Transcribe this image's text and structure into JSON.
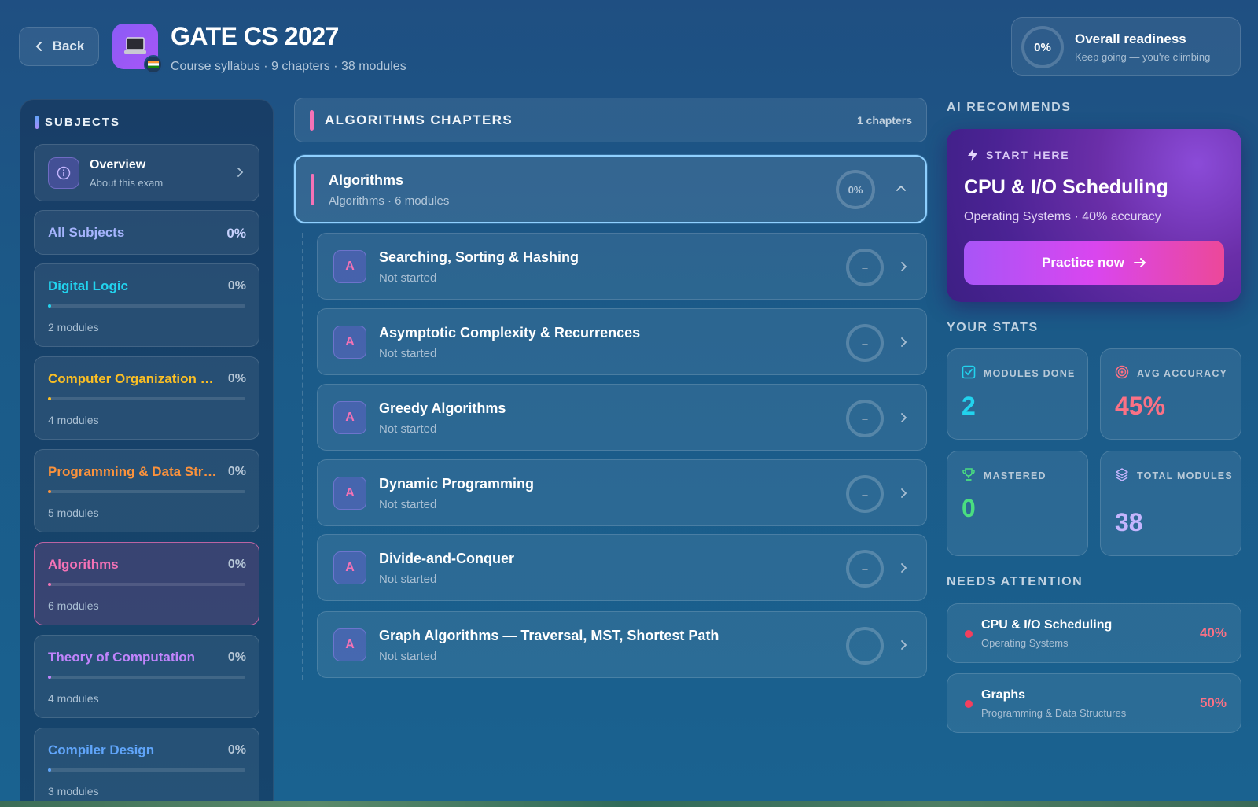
{
  "header": {
    "back_label": "Back",
    "title": "GATE CS 2027",
    "subtitle": "Course syllabus · 9 chapters · 38 modules",
    "readiness": {
      "percent": "0%",
      "title": "Overall readiness",
      "subtitle": "Keep going — you're climbing"
    }
  },
  "sidebar": {
    "heading": "SUBJECTS",
    "overview": {
      "title": "Overview",
      "subtitle": "About this exam"
    },
    "all_subjects": {
      "label": "All Subjects",
      "percent": "0%"
    },
    "subjects": [
      {
        "name": "Digital Logic",
        "percent": "0%",
        "modules": "2 modules",
        "color": "#22d3ee"
      },
      {
        "name": "Computer Organization & Architecture",
        "percent": "0%",
        "modules": "4 modules",
        "color": "#fbbf24"
      },
      {
        "name": "Programming & Data Structures",
        "percent": "0%",
        "modules": "5 modules",
        "color": "#fb923c"
      },
      {
        "name": "Algorithms",
        "percent": "0%",
        "modules": "6 modules",
        "color": "#f472b6"
      },
      {
        "name": "Theory of Computation",
        "percent": "0%",
        "modules": "4 modules",
        "color": "#c084fc"
      },
      {
        "name": "Compiler Design",
        "percent": "0%",
        "modules": "3 modules",
        "color": "#60a5fa"
      }
    ]
  },
  "chapters": {
    "heading": "ALGORITHMS CHAPTERS",
    "count": "1 chapters",
    "chapter": {
      "name": "Algorithms",
      "subtitle": "Algorithms · 6 modules",
      "percent": "0%"
    },
    "modules": [
      {
        "badge": "A",
        "name": "Searching, Sorting & Hashing",
        "status": "Not started",
        "ring": "–"
      },
      {
        "badge": "A",
        "name": "Asymptotic Complexity & Recurrences",
        "status": "Not started",
        "ring": "–"
      },
      {
        "badge": "A",
        "name": "Greedy Algorithms",
        "status": "Not started",
        "ring": "–"
      },
      {
        "badge": "A",
        "name": "Dynamic Programming",
        "status": "Not started",
        "ring": "–"
      },
      {
        "badge": "A",
        "name": "Divide-and-Conquer",
        "status": "Not started",
        "ring": "–"
      },
      {
        "badge": "A",
        "name": "Graph Algorithms — Traversal, MST, Shortest Path",
        "status": "Not started",
        "ring": "–"
      }
    ]
  },
  "recommend": {
    "section": "AI RECOMMENDS",
    "tag": "START HERE",
    "title": "CPU & I/O Scheduling",
    "subtitle": "Operating Systems · 40% accuracy",
    "button": "Practice now"
  },
  "stats": {
    "section": "YOUR STATS",
    "items": [
      {
        "label": "MODULES DONE",
        "value": "2",
        "color": "#22d3ee"
      },
      {
        "label": "AVG ACCURACY",
        "value": "45%",
        "color": "#fb7185"
      },
      {
        "label": "MASTERED",
        "value": "0",
        "color": "#4ade80"
      },
      {
        "label": "TOTAL MODULES",
        "value": "38",
        "color": "#c4b5fd"
      }
    ]
  },
  "attention": {
    "section": "NEEDS ATTENTION",
    "items": [
      {
        "title": "CPU & I/O Scheduling",
        "subtitle": "Operating Systems",
        "percent": "40%"
      },
      {
        "title": "Graphs",
        "subtitle": "Programming & Data Structures",
        "percent": "50%"
      }
    ]
  }
}
